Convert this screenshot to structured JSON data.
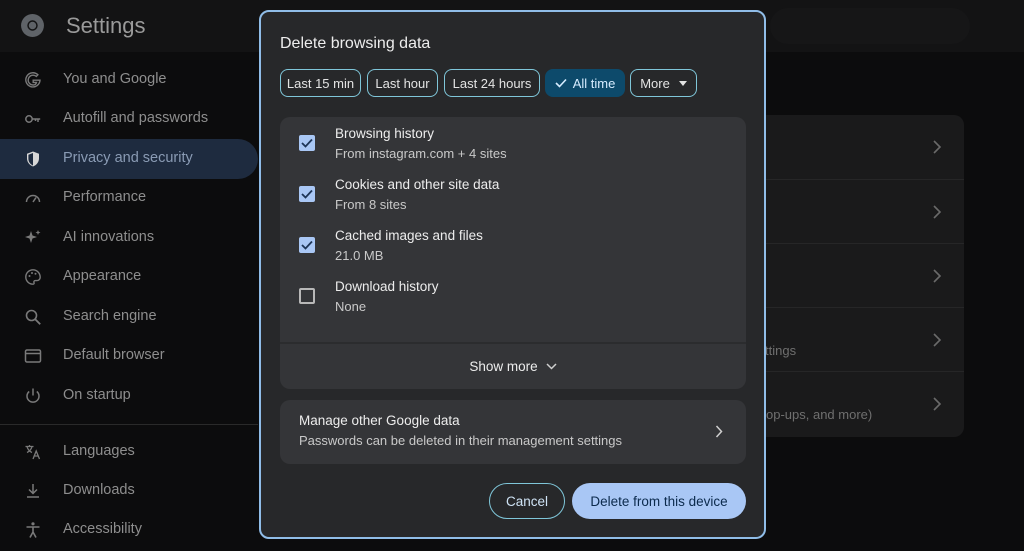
{
  "app": {
    "title": "Settings"
  },
  "sidebar": {
    "items": [
      {
        "label": "You and Google",
        "icon": "google-g-icon",
        "active": false
      },
      {
        "label": "Autofill and passwords",
        "icon": "key-icon",
        "active": false
      },
      {
        "label": "Privacy and security",
        "icon": "shield-icon",
        "active": true
      },
      {
        "label": "Performance",
        "icon": "speedometer-icon",
        "active": false
      },
      {
        "label": "AI innovations",
        "icon": "sparkle-icon",
        "active": false
      },
      {
        "label": "Appearance",
        "icon": "palette-icon",
        "active": false
      },
      {
        "label": "Search engine",
        "icon": "search-icon",
        "active": false
      },
      {
        "label": "Default browser",
        "icon": "browser-window-icon",
        "active": false
      },
      {
        "label": "On startup",
        "icon": "power-icon",
        "active": false
      },
      {
        "label": "Languages",
        "icon": "translate-icon",
        "active": false
      },
      {
        "label": "Downloads",
        "icon": "download-icon",
        "active": false
      },
      {
        "label": "Accessibility",
        "icon": "accessibility-icon",
        "active": false
      }
    ]
  },
  "background": {
    "snippet_1": "ttings",
    "snippet_2": "op-ups, and more)"
  },
  "dialog": {
    "title": "Delete browsing data",
    "time_ranges": [
      {
        "label": "Last 15 min",
        "selected": false
      },
      {
        "label": "Last hour",
        "selected": false
      },
      {
        "label": "Last 24 hours",
        "selected": false
      },
      {
        "label": "All time",
        "selected": true
      },
      {
        "label": "More",
        "selected": false,
        "has_dropdown": true
      }
    ],
    "items": [
      {
        "title": "Browsing history",
        "subtitle": "From instagram.com + 4 sites",
        "checked": true
      },
      {
        "title": "Cookies and other site data",
        "subtitle": "From 8 sites",
        "checked": true
      },
      {
        "title": "Cached images and files",
        "subtitle": "21.0 MB",
        "checked": true
      },
      {
        "title": "Download history",
        "subtitle": "None",
        "checked": false
      }
    ],
    "show_more": "Show more",
    "manage": {
      "title": "Manage other Google data",
      "subtitle": "Passwords can be deleted in their management settings"
    },
    "cancel_label": "Cancel",
    "delete_label": "Delete from this device"
  },
  "colors": {
    "accent": "#a9c7f5",
    "dialog_border": "#90bde8",
    "chip_selected": "#0d4a6b",
    "dialog_bg": "#27282a",
    "card_bg": "#343538"
  }
}
